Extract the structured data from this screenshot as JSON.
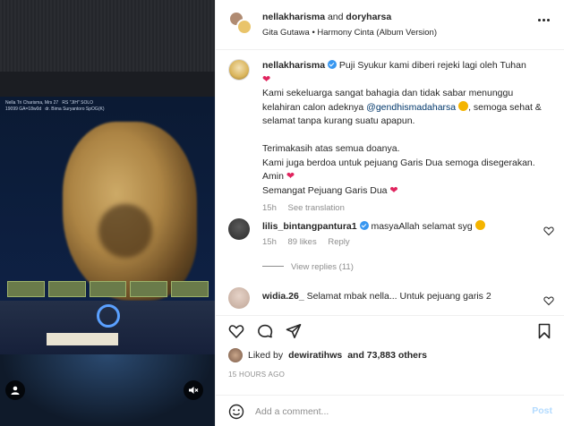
{
  "header": {
    "user1": "nellakharisma",
    "joiner": "and",
    "user2": "doryharsa",
    "music": "Gita Gutawa • Harmony Cinta (Album Version)"
  },
  "caption": {
    "username": "nellakharisma",
    "line1": "Puji Syukur kami diberi rejeki lagi oleh Tuhan",
    "line2": "Kami sekeluarga sangat bahagia dan tidak sabar menunggu kelahiran calon adeknya",
    "mention": "@gendhismadaharsa",
    "line2b": ", semoga sehat & selamat tanpa kurang suatu apapun.",
    "line3": "Terimakasih atas semua doanya.",
    "line4": "Kami juga berdoa untuk pejuang Garis Dua semoga disegerakan.",
    "line5": "Amin",
    "line6": "Semangat Pejuang Garis Dua",
    "time": "15h",
    "translate": "See translation"
  },
  "screen": {
    "patient": "Nella Tri Charisma, Mrs 27",
    "id": "19099 GA=18w0d",
    "hospital": "RS \"JIH\" SOLO",
    "doctor": "dr. Bima Suryantoro SpOG(K)"
  },
  "comments": [
    {
      "username": "lilis_bintangpantura1",
      "text": "masyaAllah selamat syg",
      "time": "15h",
      "likes": "89 likes",
      "reply": "Reply"
    },
    {
      "username": "widia.26_",
      "text": "Selamat mbak nella... Untuk pejuang garis 2"
    }
  ],
  "view_replies": "View replies (11)",
  "likes": {
    "prefix": "Liked by",
    "user": "dewiratihws",
    "suffix": "and 73,883 others"
  },
  "timestamp": "15 HOURS AGO",
  "add_comment": {
    "placeholder": "Add a comment...",
    "post_label": "Post"
  },
  "colors": {
    "verified": "#3897f0",
    "heart": "#e0245e",
    "mention": "#00376b",
    "post_disabled": "#b3dbff"
  },
  "icons": [
    "more-icon",
    "verified-icon",
    "heart-icon",
    "comment-icon",
    "share-icon",
    "bookmark-icon",
    "smile-icon",
    "user-tag-icon",
    "mute-icon"
  ]
}
